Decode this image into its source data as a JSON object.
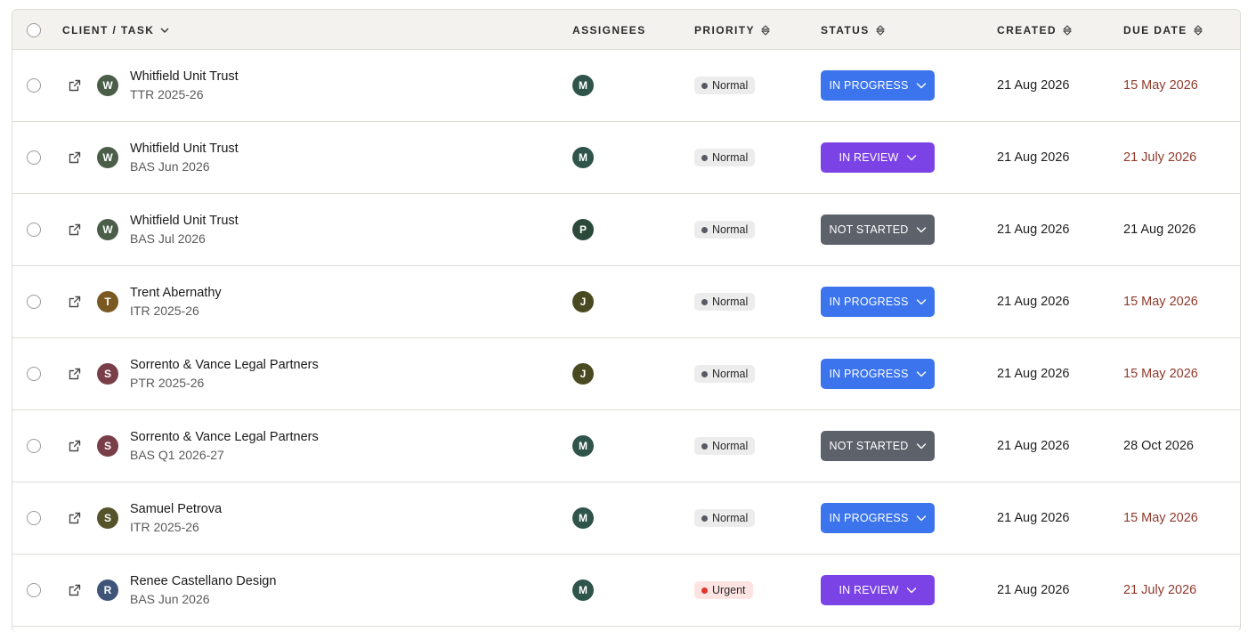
{
  "columns": {
    "client_task": "CLIENT / TASK",
    "assignees": "ASSIGNEES",
    "priority": "PRIORITY",
    "status": "STATUS",
    "created": "CREATED",
    "due_date": "DUE DATE"
  },
  "colors": {
    "in_progress": "#3b74ec",
    "in_review": "#7b43e6",
    "not_started": "#5d616a",
    "overdue_text": "#8f3a2d"
  },
  "rows": [
    {
      "client": "Whitfield Unit Trust",
      "task": "TTR 2025-26",
      "client_initial": "W",
      "client_color": "#4a5e48",
      "assignee": "M",
      "assignee_color": "#2f5449",
      "priority": "Normal",
      "status": "IN PROGRESS",
      "status_key": "in_progress",
      "created": "21 Aug 2026",
      "due": "15 May 2026",
      "overdue": true
    },
    {
      "client": "Whitfield Unit Trust",
      "task": "BAS Jun 2026",
      "client_initial": "W",
      "client_color": "#4a5e48",
      "assignee": "M",
      "assignee_color": "#2f5449",
      "priority": "Normal",
      "status": "IN REVIEW",
      "status_key": "in_review",
      "created": "21 Aug 2026",
      "due": "21 July 2026",
      "overdue": true
    },
    {
      "client": "Whitfield Unit Trust",
      "task": "BAS Jul 2026",
      "client_initial": "W",
      "client_color": "#4a5e48",
      "assignee": "P",
      "assignee_color": "#2c4a3a",
      "priority": "Normal",
      "status": "NOT STARTED",
      "status_key": "not_started",
      "created": "21 Aug 2026",
      "due": "21 Aug 2026",
      "overdue": false
    },
    {
      "client": "Trent Abernathy",
      "task": "ITR 2025-26",
      "client_initial": "T",
      "client_color": "#7a5a22",
      "assignee": "J",
      "assignee_color": "#4a4a22",
      "priority": "Normal",
      "status": "IN PROGRESS",
      "status_key": "in_progress",
      "created": "21 Aug 2026",
      "due": "15 May 2026",
      "overdue": true
    },
    {
      "client": "Sorrento & Vance Legal Partners",
      "task": "PTR 2025-26",
      "client_initial": "S",
      "client_color": "#7a3e48",
      "assignee": "J",
      "assignee_color": "#4a4a22",
      "priority": "Normal",
      "status": "IN PROGRESS",
      "status_key": "in_progress",
      "created": "21 Aug 2026",
      "due": "15 May 2026",
      "overdue": true
    },
    {
      "client": "Sorrento & Vance Legal Partners",
      "task": "BAS Q1 2026-27",
      "client_initial": "S",
      "client_color": "#7a3e48",
      "assignee": "M",
      "assignee_color": "#2f5449",
      "priority": "Normal",
      "status": "NOT STARTED",
      "status_key": "not_started",
      "created": "21 Aug 2026",
      "due": "28 Oct 2026",
      "overdue": false
    },
    {
      "client": "Samuel Petrova",
      "task": "ITR 2025-26",
      "client_initial": "S",
      "client_color": "#54532a",
      "assignee": "M",
      "assignee_color": "#2f5449",
      "priority": "Normal",
      "status": "IN PROGRESS",
      "status_key": "in_progress",
      "created": "21 Aug 2026",
      "due": "15 May 2026",
      "overdue": true
    },
    {
      "client": "Renee Castellano Design",
      "task": "BAS Jun 2026",
      "client_initial": "R",
      "client_color": "#3e5478",
      "assignee": "M",
      "assignee_color": "#2f5449",
      "priority": "Urgent",
      "status": "IN REVIEW",
      "status_key": "in_review",
      "created": "21 Aug 2026",
      "due": "21 July 2026",
      "overdue": true
    }
  ]
}
